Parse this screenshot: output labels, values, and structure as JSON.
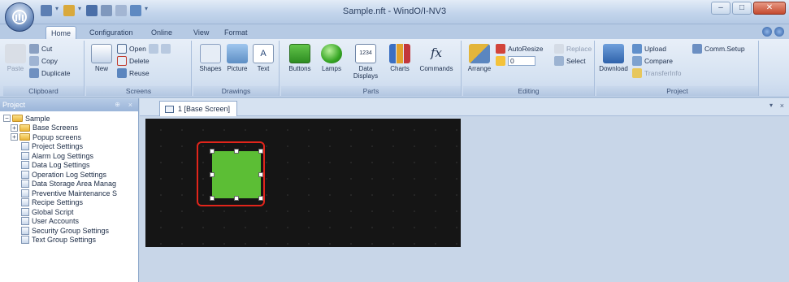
{
  "window": {
    "title": "Sample.nft - WindO/I-NV3"
  },
  "tabs": [
    "Home",
    "Configuration",
    "Online",
    "View",
    "Format"
  ],
  "ribbon": {
    "clipboard": {
      "label": "Clipboard",
      "paste": "Paste",
      "cut": "Cut",
      "copy": "Copy",
      "duplicate": "Duplicate"
    },
    "screens": {
      "label": "Screens",
      "new": "New",
      "open": "Open",
      "delete": "Delete",
      "reuse": "Reuse"
    },
    "drawings": {
      "label": "Drawings",
      "shapes": "Shapes",
      "picture": "Picture",
      "text": "Text"
    },
    "parts": {
      "label": "Parts",
      "buttons": "Buttons",
      "lamps": "Lamps",
      "data_displays": "Data Displays",
      "data_display_value": "1234",
      "charts": "Charts",
      "commands": "Commands",
      "commands_symbol": "fx"
    },
    "editing": {
      "label": "Editing",
      "arrange": "Arrange",
      "autoresize": "AutoResize",
      "replace": "Replace",
      "select": "Select",
      "zoom_value": "0"
    },
    "project": {
      "label": "Project",
      "download": "Download",
      "upload": "Upload",
      "compare": "Compare",
      "transfer": "TransferInfo",
      "comm_setup": "Comm.Setup"
    }
  },
  "project_pane": {
    "title": "Project",
    "pin": "⊕",
    "close": "×",
    "tree": [
      {
        "label": "Sample",
        "level": 0,
        "type": "folder",
        "expander": "−"
      },
      {
        "label": "Base Screens",
        "level": 1,
        "type": "folder",
        "expander": "+"
      },
      {
        "label": "Popup screens",
        "level": 1,
        "type": "folder",
        "expander": "+"
      },
      {
        "label": "Project Settings",
        "level": 2,
        "type": "page"
      },
      {
        "label": "Alarm Log Settings",
        "level": 2,
        "type": "page"
      },
      {
        "label": "Data Log Settings",
        "level": 2,
        "type": "page"
      },
      {
        "label": "Operation Log Settings",
        "level": 2,
        "type": "page"
      },
      {
        "label": "Data Storage Area Manag",
        "level": 2,
        "type": "page"
      },
      {
        "label": "Preventive Maintenance S",
        "level": 2,
        "type": "page"
      },
      {
        "label": "Recipe Settings",
        "level": 2,
        "type": "page"
      },
      {
        "label": "Global Script",
        "level": 2,
        "type": "page"
      },
      {
        "label": "User Accounts",
        "level": 2,
        "type": "page"
      },
      {
        "label": "Security Group Settings",
        "level": 2,
        "type": "page"
      },
      {
        "label": "Text Group Settings",
        "level": 2,
        "type": "page"
      }
    ]
  },
  "editor": {
    "tab_label": "1  [Base Screen]",
    "close": "×",
    "arrow": "▾"
  },
  "colors": {
    "lamp_green": "#5cbe35",
    "highlight_red": "#e1251b",
    "canvas_black": "#151515"
  }
}
